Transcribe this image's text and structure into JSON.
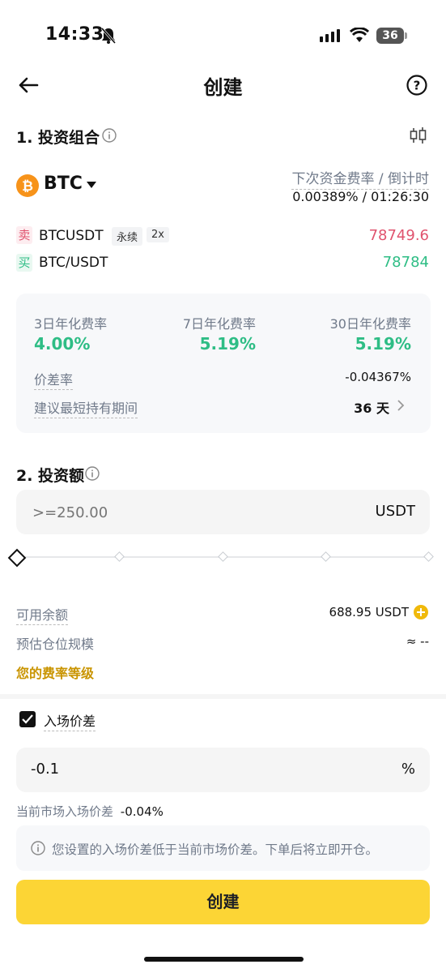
{
  "status_bar": {
    "time": "14:33",
    "battery": "36"
  },
  "header": {
    "title": "创建"
  },
  "section1": {
    "title": "1. 投资组合"
  },
  "asset": {
    "symbol": "BTC",
    "funding_label": "下次资金费率 / 倒计时",
    "funding_value": "0.00389% / 01:26:30"
  },
  "pairs": [
    {
      "side": "卖",
      "name": "BTCUSDT",
      "tag": "永续",
      "leverage": "2x",
      "price": "78749.6"
    },
    {
      "side": "买",
      "name": "BTC/USDT",
      "price": "78784"
    }
  ],
  "rates": [
    {
      "label": "3日年化费率",
      "value": "4.00%"
    },
    {
      "label": "7日年化费率",
      "value": "5.19%"
    },
    {
      "label": "30日年化费率",
      "value": "5.19%"
    }
  ],
  "spread": {
    "label": "价差率",
    "value": "-0.04367%"
  },
  "hold_period": {
    "label": "建议最短持有期间",
    "value": "36 天"
  },
  "section2": {
    "title": "2. 投资额"
  },
  "amount_input": {
    "placeholder": ">=250.00",
    "unit": "USDT"
  },
  "slider": {
    "value": 0
  },
  "available": {
    "label": "可用余额",
    "value": "688.95 USDT"
  },
  "position": {
    "label": "预估仓位规模",
    "value": "≈ --"
  },
  "fee_tier": {
    "label": "您的费率等级"
  },
  "entry_spread": {
    "label": "入场价差",
    "checked": true,
    "value": "-0.1",
    "unit": "%"
  },
  "market_spread": {
    "label": "当前市场入场价差",
    "value": "-0.04%"
  },
  "notice": {
    "text": "您设置的入场价差低于当前市场价差。下单后将立即开仓。"
  },
  "submit": {
    "label": "创建"
  },
  "colors": {
    "accent": "#FCD535",
    "green": "#2EBD85",
    "red": "#E0536E",
    "btc": "#F7931A"
  }
}
